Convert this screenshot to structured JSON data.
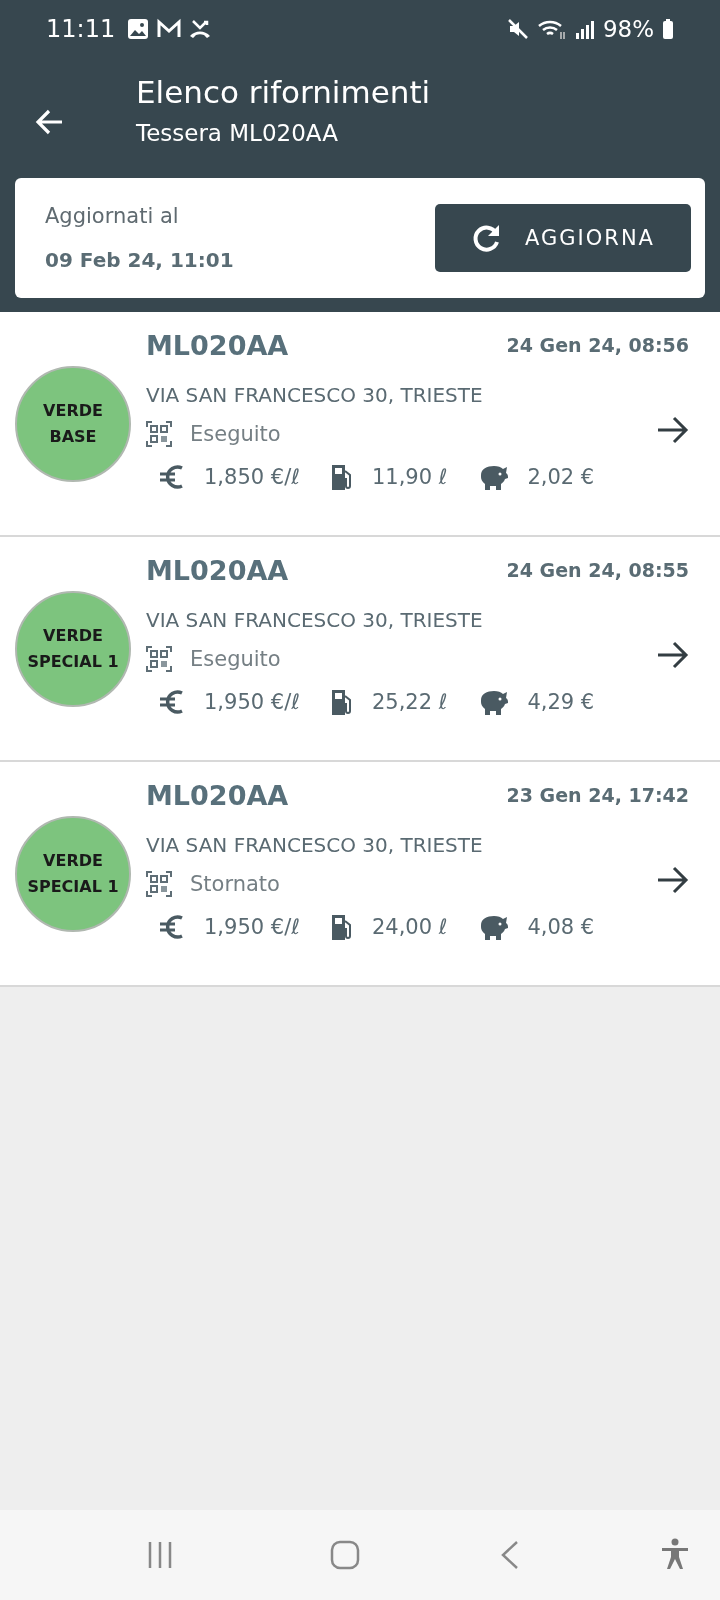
{
  "status_bar": {
    "time": "11:11",
    "battery": "98%"
  },
  "header": {
    "title": "Elenco rifornimenti",
    "subtitle": "Tessera ML020AA"
  },
  "update_card": {
    "label": "Aggiornati al",
    "date": "09 Feb 24, 11:01",
    "button": "AGGIORNA"
  },
  "refuelings": [
    {
      "fuel": "VERDE BASE",
      "plate": "ML020AA",
      "date": "24 Gen 24, 08:56",
      "address": "VIA SAN FRANCESCO 30, TRIESTE",
      "status": "Eseguito",
      "price": "1,850 €/ℓ",
      "liters": "11,90 ℓ",
      "saving": "2,02 €"
    },
    {
      "fuel": "VERDE SPECIAL 1",
      "plate": "ML020AA",
      "date": "24 Gen 24, 08:55",
      "address": "VIA SAN FRANCESCO 30, TRIESTE",
      "status": "Eseguito",
      "price": "1,950 €/ℓ",
      "liters": "25,22 ℓ",
      "saving": "4,29 €"
    },
    {
      "fuel": "VERDE SPECIAL 1",
      "plate": "ML020AA",
      "date": "23 Gen 24, 17:42",
      "address": "VIA SAN FRANCESCO 30, TRIESTE",
      "status": "Stornato",
      "price": "1,950 €/ℓ",
      "liters": "24,00 ℓ",
      "saving": "4,08 €"
    }
  ]
}
